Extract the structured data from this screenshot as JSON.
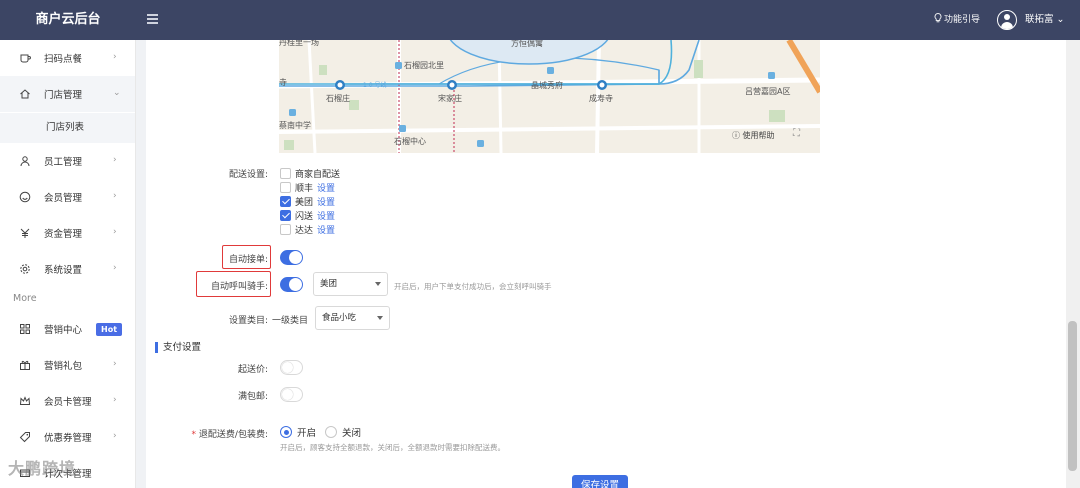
{
  "header": {
    "brand": "商户云后台",
    "guide_label": "功能引导",
    "user_name": "联拓富"
  },
  "sidebar": {
    "items": [
      {
        "label": "扫码点餐",
        "icon": "cup-icon"
      },
      {
        "label": "门店管理",
        "icon": "home-icon"
      },
      {
        "label": "员工管理",
        "icon": "person-icon"
      },
      {
        "label": "会员管理",
        "icon": "smile-icon"
      },
      {
        "label": "资金管理",
        "icon": "yen-icon"
      },
      {
        "label": "系统设置",
        "icon": "gear-icon"
      }
    ],
    "sub_item": "门店列表",
    "more_label": "More",
    "more_items": [
      {
        "label": "营销中心",
        "icon": "grid-icon",
        "badge": "Hot"
      },
      {
        "label": "营销礼包",
        "icon": "gift-icon"
      },
      {
        "label": "会员卡管理",
        "icon": "crown-icon"
      },
      {
        "label": "优惠券管理",
        "icon": "tag-icon"
      },
      {
        "label": "计次卡管理",
        "icon": "card-icon"
      }
    ]
  },
  "map": {
    "labels": {
      "yuquanlu": "丹桂里一场",
      "fangheng": "方恒偶寓",
      "shiliuyuan": "石榴园北里",
      "si": "寺",
      "line10": "1 0 号线",
      "shiliuzhuang": "石榴庄",
      "songjiazhuang": "宋家庄",
      "jingchengxiufu": "晶城秀府",
      "chengshousi": "成寿寺",
      "lvying": "吕营嘉园A区",
      "chengnan": "蔡南中学",
      "shiliucenter": "石榴中心"
    },
    "help": "使用帮助"
  },
  "form": {
    "delivery_label": "配送设置:",
    "delivery_options": [
      {
        "name": "商家自配送",
        "checked": false,
        "link": ""
      },
      {
        "name": "顺丰",
        "checked": false,
        "link": "设置"
      },
      {
        "name": "美团",
        "checked": true,
        "link": "设置"
      },
      {
        "name": "闪送",
        "checked": true,
        "link": "设置"
      },
      {
        "name": "达达",
        "checked": false,
        "link": "设置"
      }
    ],
    "auto_accept_label": "自动接单:",
    "auto_call_label": "自动呼叫骑手:",
    "auto_call_select": "美团",
    "auto_call_hint": "开启后，用户下单支付成功后，会立刻呼叫骑手",
    "category_label": "设置类目:",
    "category_level": "一级类目",
    "category_select": "食品小吃",
    "pay_section": "支付设置",
    "min_price_label": "起送价:",
    "free_ship_label": "满包邮:",
    "refund_label": "退配送费/包装费:",
    "refund_required": "*",
    "refund_on": "开启",
    "refund_off": "关闭",
    "refund_hint": "开启后，顾客支持全额退款，关闭后，全额退款时需要扣除配送费。",
    "save": "保存设置"
  },
  "watermark": "大鹏跨境"
}
